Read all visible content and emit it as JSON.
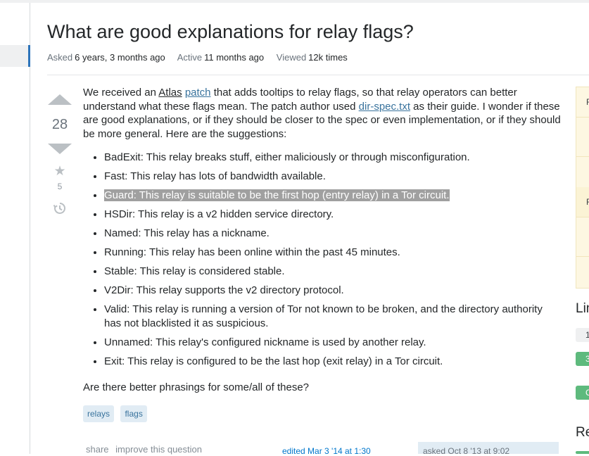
{
  "question": {
    "title": "What are good explanations for relay flags?",
    "meta": {
      "asked_label": "Asked",
      "asked_value": "6 years, 3 months ago",
      "active_label": "Active",
      "active_value": "11 months ago",
      "viewed_label": "Viewed",
      "viewed_value": "12k times"
    },
    "votes": "28",
    "favorites": "5",
    "body": {
      "p1_before_atlas": "We received an ",
      "atlas_link": "Atlas",
      "space": " ",
      "patch_link": "patch",
      "p1_mid": " that adds tooltips to relay flags, so that relay operators can better understand what these flags mean. The patch author used ",
      "dirspec_link": "dir-spec.txt",
      "p1_end": " as their guide. I wonder if these are good explanations, or if they should be closer to the spec or even implementation, or if they should be more general. Here are the suggestions:",
      "flags": [
        "BadExit: This relay breaks stuff, either maliciously or through misconfiguration.",
        "Fast: This relay has lots of bandwidth available.",
        "Guard: This relay is suitable to be the first hop (entry relay) in a Tor circuit.",
        "HSDir: This relay is a v2 hidden service directory.",
        "Named: This relay has a nickname.",
        "Running: This relay has been online within the past 45 minutes.",
        "Stable: This relay is considered stable.",
        "V2Dir: This relay supports the v2 directory protocol.",
        "Valid: This relay is running a version of Tor not known to be broken, and the directory authority has not blacklisted it as suspicious.",
        "Unnamed: This relay's configured nickname is used by another relay.",
        "Exit: This relay is configured to be the last hop (exit relay) in a Tor circuit."
      ],
      "closing": "Are there better phrasings for some/all of these?"
    },
    "tags": [
      "relays",
      "flags"
    ],
    "post_menu": {
      "share": "share",
      "improve": "improve this question"
    },
    "edited": "edited Mar 3 '14 at 1:30",
    "asked": "asked Oct 8 '13 at 9:02"
  },
  "sidebar": {
    "box_chars": [
      "F",
      "F"
    ],
    "linked_heading": "Lin",
    "linked_pill_1": "1",
    "linked_pill_2": "3",
    "linked_pill_3": "C",
    "related_heading": "Re"
  },
  "icons": {
    "upvote": "triangle-up",
    "downvote": "triangle-down",
    "favorite": "star",
    "history": "clock-history"
  },
  "colors": {
    "link": "#39739d",
    "tag_bg": "#e1ecf4",
    "vote_arrow": "#bbc0c4",
    "active_nav": "#2c73ba",
    "highlight": "#a0a0a0",
    "pill_green": "#5eba7d"
  }
}
